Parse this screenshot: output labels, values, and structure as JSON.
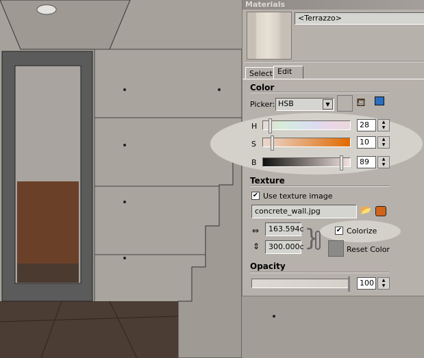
{
  "panel": {
    "title": "Materials",
    "material_name": "<Terrazzo>",
    "tabs": [
      {
        "label": "Select",
        "active": false
      },
      {
        "label": "Edit",
        "active": true
      }
    ],
    "color": {
      "header": "Color",
      "picker_label": "Picker:",
      "picker_value": "HSB",
      "icons": [
        "sample-paint-icon",
        "match-screen-color-icon"
      ],
      "h": {
        "label": "H",
        "value": "28"
      },
      "s": {
        "label": "S",
        "value": "10"
      },
      "b": {
        "label": "B",
        "value": "89"
      }
    },
    "texture": {
      "header": "Texture",
      "use_texture_label": "Use texture image",
      "use_texture_checked": true,
      "filename": "concrete_wall.jpg",
      "width": "163.594c",
      "height": "300.000c",
      "colorize_label": "Colorize",
      "colorize_checked": true,
      "reset_color_label": "Reset Color",
      "icons": [
        "browse-folder-icon",
        "edit-texture-icon",
        "lock-aspect-chain-icon"
      ]
    },
    "opacity": {
      "header": "Opacity",
      "value": "100"
    }
  },
  "colors": {
    "accent_orange": "#e06a00",
    "panel_bg": "#b7b1ac",
    "highlight": "#d3d1c9"
  }
}
